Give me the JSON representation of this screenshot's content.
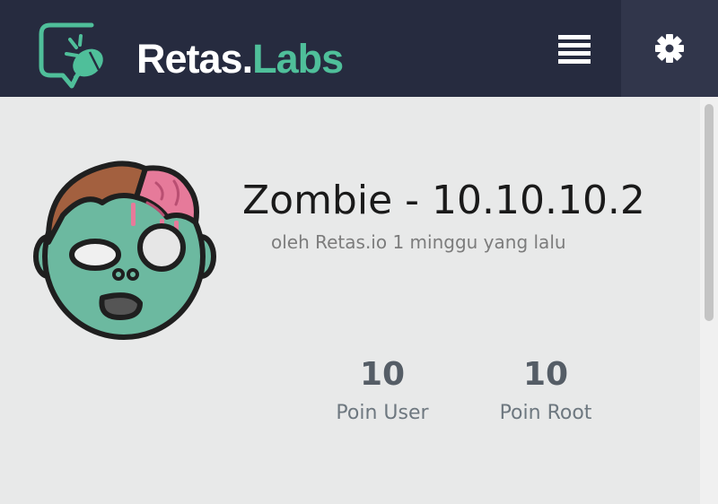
{
  "header": {
    "brand_primary": "Retas.",
    "brand_accent": "Labs",
    "logo_icon": "bug-monitor-icon",
    "menu_icon": "list-icon",
    "settings_icon": "gear-icon",
    "colors": {
      "background": "#262b3f",
      "settings_background": "#31364b",
      "accent": "#4fbf9a",
      "text": "#ffffff"
    }
  },
  "machine": {
    "title": "Zombie - 10.10.10.2",
    "meta": "oleh Retas.io 1 minggu yang lalu",
    "avatar_icon": "zombie-face-icon",
    "stats": [
      {
        "value": "10",
        "label": "Poin User"
      },
      {
        "value": "10",
        "label": "Poin Root"
      }
    ]
  }
}
